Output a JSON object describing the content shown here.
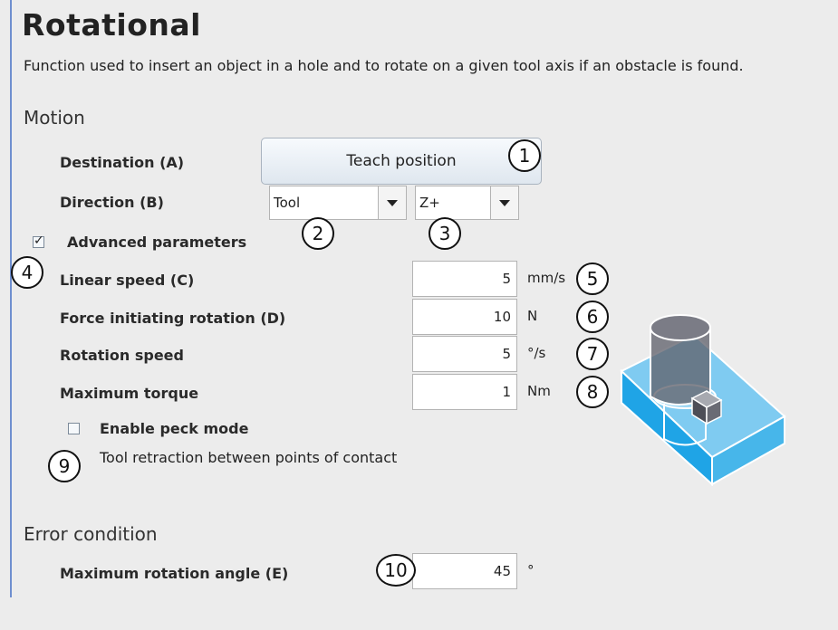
{
  "title": "Rotational",
  "description": "Function used to insert an object in a hole and to rotate on a given tool axis if an obstacle is found.",
  "motion": {
    "section_label": "Motion",
    "destination_label": "Destination (A)",
    "teach_button_label": "Teach position",
    "direction_label": "Direction (B)",
    "direction_frame": "Tool",
    "direction_axis": "Z+",
    "advanced_label": "Advanced parameters",
    "advanced_checked": true
  },
  "params": [
    {
      "label": "Linear speed (C)",
      "value": "5",
      "unit": "mm/s"
    },
    {
      "label": "Force initiating rotation (D)",
      "value": "10",
      "unit": "N"
    },
    {
      "label": "Rotation speed",
      "value": "5",
      "unit": "°/s"
    },
    {
      "label": "Maximum torque",
      "value": "1",
      "unit": "Nm"
    }
  ],
  "peck": {
    "label": "Enable peck mode",
    "checked": false,
    "description": "Tool retraction between points of contact"
  },
  "error": {
    "section_label": "Error condition",
    "max_angle_label": "Maximum rotation angle (E)",
    "max_angle_value": "45",
    "max_angle_unit": "°"
  },
  "callouts": [
    "1",
    "2",
    "3",
    "4",
    "5",
    "6",
    "7",
    "8",
    "9",
    "10"
  ],
  "icons": {
    "checkbox_check": "check-icon",
    "dropdown": "chevron-down-icon"
  },
  "colors": {
    "block_light": "#7fcbf1",
    "block_front": "#1fa4e6",
    "block_side": "#47b6ea",
    "cylinder": "#62636d",
    "edge_accent": "#6f8fcf"
  }
}
